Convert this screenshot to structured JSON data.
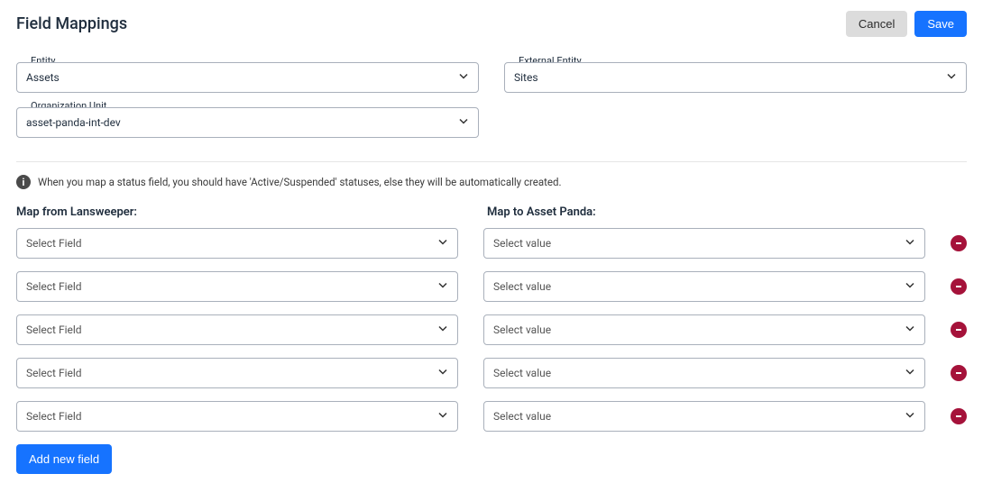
{
  "header": {
    "title": "Field Mappings",
    "cancel": "Cancel",
    "save": "Save"
  },
  "top": {
    "entity_label": "Entity",
    "entity_value": "Assets",
    "external_entity_label": "External Entity",
    "external_entity_value": "Sites",
    "org_unit_label": "Organization Unit",
    "org_unit_value": "asset-panda-int-dev"
  },
  "info": {
    "text": "When you map a status field, you should have 'Active/Suspended' statuses, else they will be automatically created."
  },
  "sections": {
    "from": "Map from Lansweeper:",
    "to": "Map to Asset Panda:"
  },
  "rows": [
    {
      "from_placeholder": "Select Field",
      "to_placeholder": "Select value"
    },
    {
      "from_placeholder": "Select Field",
      "to_placeholder": "Select value"
    },
    {
      "from_placeholder": "Select Field",
      "to_placeholder": "Select value"
    },
    {
      "from_placeholder": "Select Field",
      "to_placeholder": "Select value"
    },
    {
      "from_placeholder": "Select Field",
      "to_placeholder": "Select value"
    }
  ],
  "add_button": "Add new field"
}
